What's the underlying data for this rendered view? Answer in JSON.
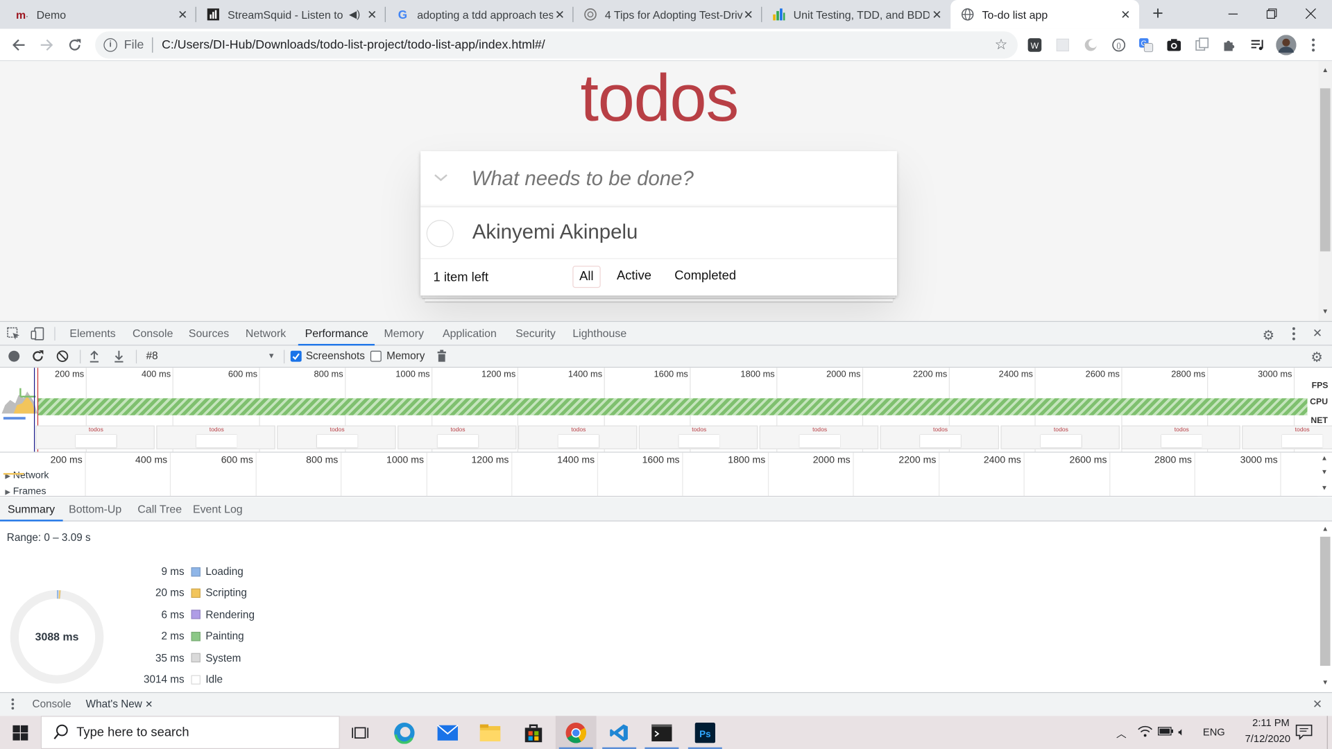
{
  "browser": {
    "tabs": [
      {
        "title": "Demo",
        "favicon": "mendeley-icon"
      },
      {
        "title": "StreamSquid - Listen to F",
        "favicon": "streamsquid-icon"
      },
      {
        "title": "adopting a tdd approach tes",
        "favicon": "google-icon"
      },
      {
        "title": "4 Tips for Adopting Test-Driv",
        "favicon": "site-icon"
      },
      {
        "title": "Unit Testing, TDD, and BDD, ",
        "favicon": "bars-icon"
      },
      {
        "title": "To-do list app",
        "favicon": "globe-icon"
      }
    ],
    "new_tab": "+",
    "close": "✕",
    "url_prefix": "File",
    "url": "C:/Users/DI-Hub/Downloads/todo-list-project/todo-list-app/index.html#/"
  },
  "app": {
    "title": "todos",
    "placeholder": "What needs to be done?",
    "items": [
      {
        "text": "Akinyemi Akinpelu",
        "completed": false
      }
    ],
    "count_text": "1 item left",
    "filters": [
      "All",
      "Active",
      "Completed"
    ],
    "selected_filter": "All"
  },
  "devtools": {
    "tabs": [
      "Elements",
      "Console",
      "Sources",
      "Network",
      "Performance",
      "Memory",
      "Application",
      "Security",
      "Lighthouse"
    ],
    "selected_tab": "Performance",
    "profile_select": "#8",
    "screenshots_label": "Screenshots",
    "screenshots_checked": true,
    "memory_label": "Memory",
    "memory_checked": false,
    "overview_ticks": [
      "200 ms",
      "400 ms",
      "600 ms",
      "800 ms",
      "1000 ms",
      "1200 ms",
      "1400 ms",
      "1600 ms",
      "1800 ms",
      "2000 ms",
      "2200 ms",
      "2400 ms",
      "2600 ms",
      "2800 ms",
      "3000 ms"
    ],
    "lane_labels": [
      "FPS",
      "CPU",
      "NET"
    ],
    "thumb_label": "todos",
    "tracks": [
      "Network",
      "Frames"
    ],
    "bottom_tabs": [
      "Summary",
      "Bottom-Up",
      "Call Tree",
      "Event Log"
    ],
    "range": "Range: 0 – 3.09 s",
    "total": "3088 ms",
    "summary": [
      {
        "value": "9 ms",
        "label": "Loading",
        "color": "#8fb6e8"
      },
      {
        "value": "20 ms",
        "label": "Scripting",
        "color": "#f2c55c"
      },
      {
        "value": "6 ms",
        "label": "Rendering",
        "color": "#af9ce6"
      },
      {
        "value": "2 ms",
        "label": "Painting",
        "color": "#8cc887"
      },
      {
        "value": "35 ms",
        "label": "System",
        "color": "#dadada"
      },
      {
        "value": "3014 ms",
        "label": "Idle",
        "color": "#ffffff"
      }
    ],
    "drawer_tabs": [
      "Console",
      "What's New"
    ]
  },
  "taskbar": {
    "search_placeholder": "Type here to search",
    "lang": "ENG",
    "time": "2:11 PM",
    "date": "7/12/2020"
  }
}
